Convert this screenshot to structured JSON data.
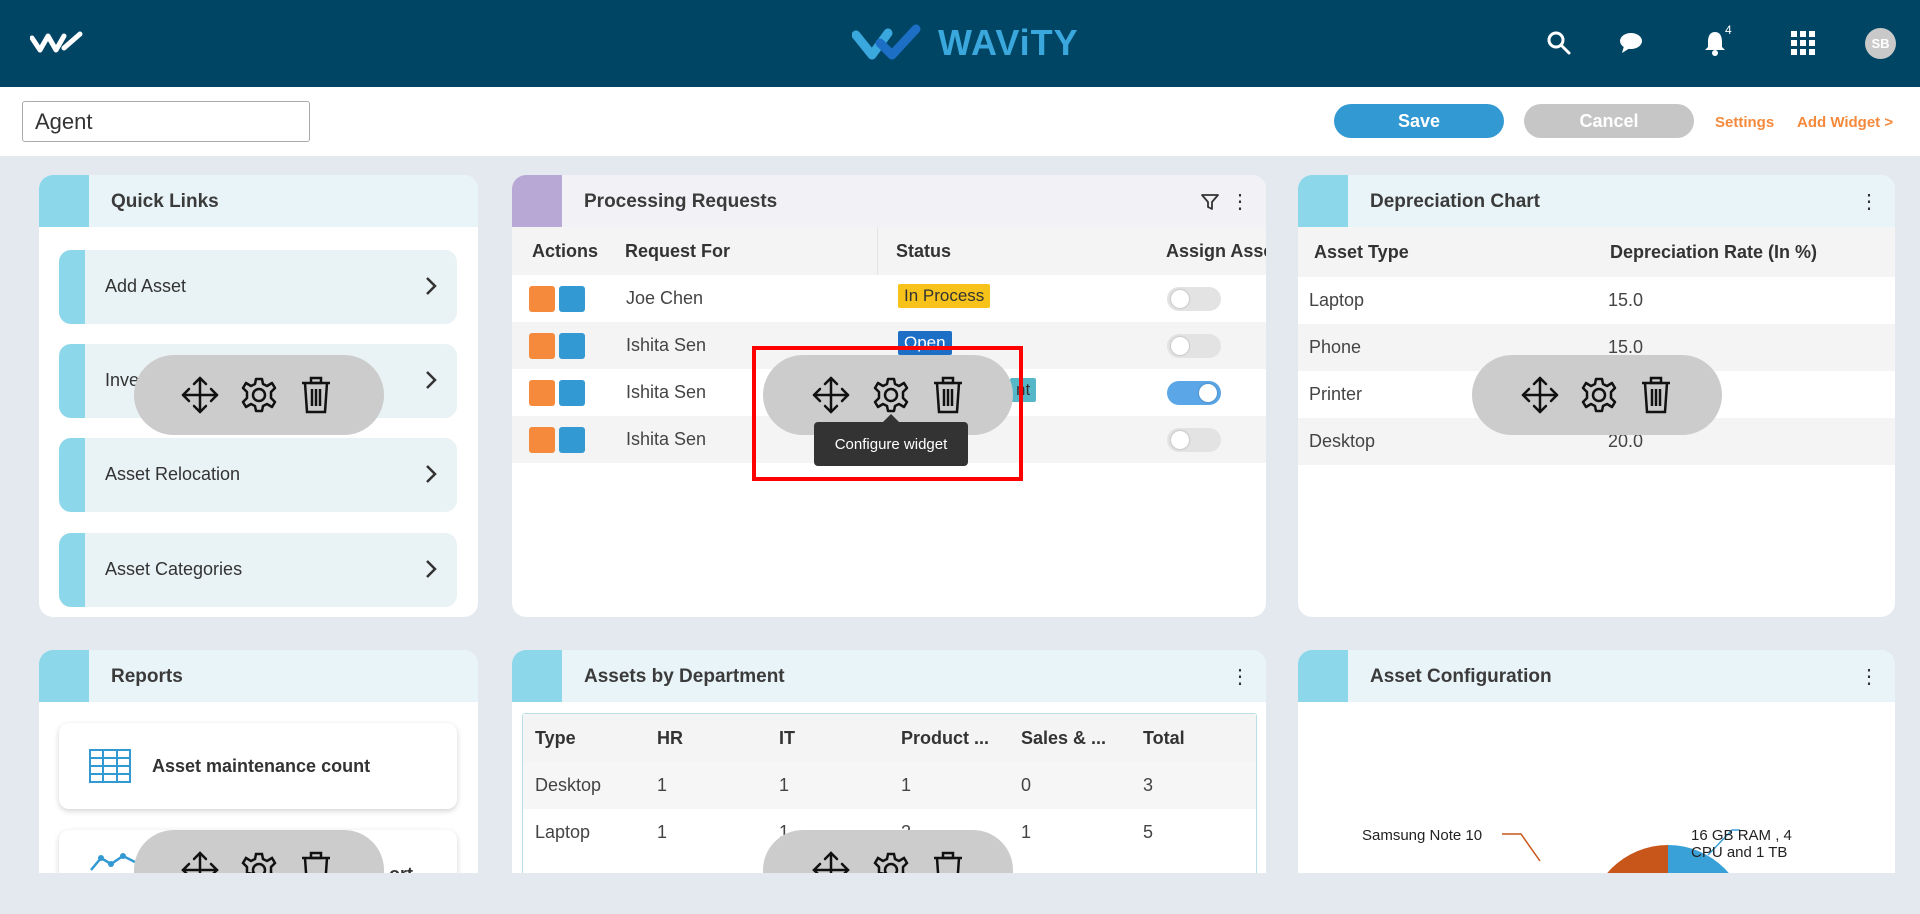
{
  "header": {
    "brand": "WAViTY",
    "notification_count": "4",
    "avatar_initials": "SB"
  },
  "editbar": {
    "page_name": "Agent",
    "save_label": "Save",
    "cancel_label": "Cancel",
    "settings_label": "Settings",
    "add_widget_label": "Add Widget >"
  },
  "quick_links": {
    "title": "Quick Links",
    "items": [
      {
        "label": "Add Asset"
      },
      {
        "label": "Inve"
      },
      {
        "label": "Asset Relocation"
      },
      {
        "label": "Asset Categories"
      }
    ]
  },
  "processing_requests": {
    "title": "Processing Requests",
    "columns": [
      "Actions",
      "Request For",
      "Status",
      "Assign Asse"
    ],
    "rows": [
      {
        "request_for": "Joe Chen",
        "status": "In Process",
        "assign": false
      },
      {
        "request_for": "Ishita Sen",
        "status": "Open",
        "assign": false
      },
      {
        "request_for": "Ishita Sen",
        "status": "nt",
        "assign": true
      },
      {
        "request_for": "Ishita Sen",
        "status": "",
        "assign": false
      }
    ]
  },
  "depreciation_chart": {
    "title": "Depreciation Chart",
    "columns": [
      "Asset Type",
      "Depreciation Rate (In %)"
    ],
    "rows": [
      {
        "type": "Laptop",
        "rate": "15.0"
      },
      {
        "type": "Phone",
        "rate": "15.0"
      },
      {
        "type": "Printer",
        "rate": ""
      },
      {
        "type": "Desktop",
        "rate": "20.0"
      }
    ]
  },
  "reports": {
    "title": "Reports",
    "items": [
      {
        "label": "Asset maintenance count"
      },
      {
        "label": "ort"
      }
    ]
  },
  "assets_by_department": {
    "title": "Assets by Department",
    "columns": [
      "Type",
      "HR",
      "IT",
      "Product ...",
      "Sales & ...",
      "Total"
    ],
    "rows": [
      [
        "Desktop",
        "1",
        "1",
        "1",
        "0",
        "3"
      ],
      [
        "Laptop",
        "1",
        "1",
        "2",
        "1",
        "5"
      ]
    ]
  },
  "asset_configuration": {
    "title": "Asset Configuration",
    "labels": [
      "Samsung Note 10",
      "16 GB RAM , 4",
      "CPU and 1 TB"
    ]
  },
  "tooltip": {
    "text": "Configure widget"
  },
  "colors": {
    "topbar": "#004664",
    "accent": "#8dd7ea",
    "primary": "#3399d3",
    "orange": "#f58a3c",
    "highlight": "#ff0000",
    "status_in_process": "#f7c31a",
    "status_open": "#1d6fc6",
    "status_other": "#56b7c9"
  }
}
